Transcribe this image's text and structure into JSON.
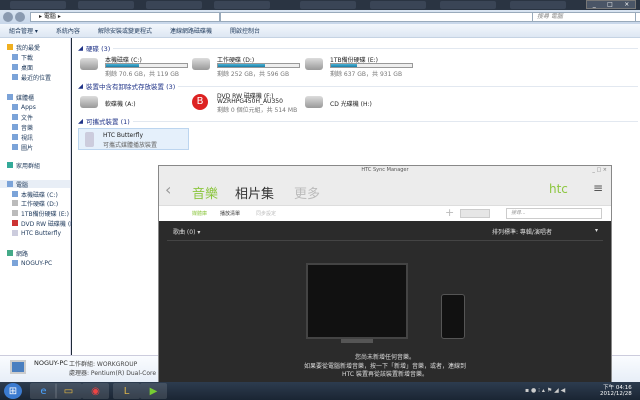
{
  "explorer": {
    "breadcrumb": "電腦",
    "search_placeholder": "搜尋 電腦",
    "toolbar": [
      "組合管理 ▾",
      "系統內容",
      "解除安裝或變更程式",
      "連線網路磁碟機",
      "開啟控制台"
    ],
    "sidebar": {
      "favorites": {
        "label": "我的最愛",
        "items": [
          "下載",
          "桌面",
          "最近的位置"
        ]
      },
      "libraries": {
        "label": "媒體櫃",
        "items": [
          "Apps",
          "文件",
          "音樂",
          "視訊",
          "圖片"
        ]
      },
      "homegroup": "家用群組",
      "computer": {
        "label": "電腦",
        "items": [
          "本機磁碟 (C:)",
          "工作硬碟 (D:)",
          "1TB備份硬碟 (E:)",
          "DVD RW 磁碟機 (F:)",
          "HTC Butterfly"
        ]
      },
      "network": {
        "label": "網路",
        "items": [
          "NOGUY-PC"
        ]
      }
    },
    "sections": {
      "hdd": "硬碟 (3)",
      "removable": "裝置中含有卸除式存放裝置 (3)",
      "portable": "可攜式裝置 (1)"
    },
    "drives": [
      {
        "name": "本機磁碟 (C:)",
        "free": "剩餘 70.6 GB，共 119 GB",
        "used_fraction": 0.41
      },
      {
        "name": "工作硬碟 (D:)",
        "free": "剩餘 252 GB，共 596 GB",
        "used_fraction": 0.58
      },
      {
        "name": "1TB備份硬碟 (E:)",
        "free": "剩餘 637 GB，共 931 GB",
        "used_fraction": 0.32
      }
    ],
    "removable": [
      {
        "name": "軟碟機 (A:)"
      },
      {
        "name": "DVD RW 磁碟機 (F:)",
        "label": "WZRHPG450H_AU350",
        "free": "剩餘 0 個位元組，共 514 MB"
      },
      {
        "name": "CD 光碟機 (H:)"
      }
    ],
    "portable": {
      "name": "HTC Butterfly",
      "desc": "可攜式媒體播放裝置"
    },
    "details": {
      "name": "NOGUY-PC",
      "workgroup": "工作群組: WORKGROUP",
      "cpu": "處理器: Pentium(R) Dual-Core ..."
    }
  },
  "htc": {
    "title": "HTC Sync Manager",
    "tabs": [
      "音樂",
      "相片集",
      "更多"
    ],
    "logo": "htc",
    "subtabs": [
      "媒體庫",
      "播放清單",
      "同步設定"
    ],
    "search_placeholder": "搜尋...",
    "songs": "歌曲 (0) ▾",
    "sort": "排列標準: 專輯/演唱者",
    "empty_title": "您尚未新增任何音樂。",
    "empty_body": "如果要從電腦新增音樂，按一下「新增」音樂，或者，連線到 HTC 裝置再從該裝置新增音樂。",
    "accent": "#8cc63f"
  },
  "taskbar": {
    "time": "下午 04:16",
    "date": "2012/12/28"
  }
}
